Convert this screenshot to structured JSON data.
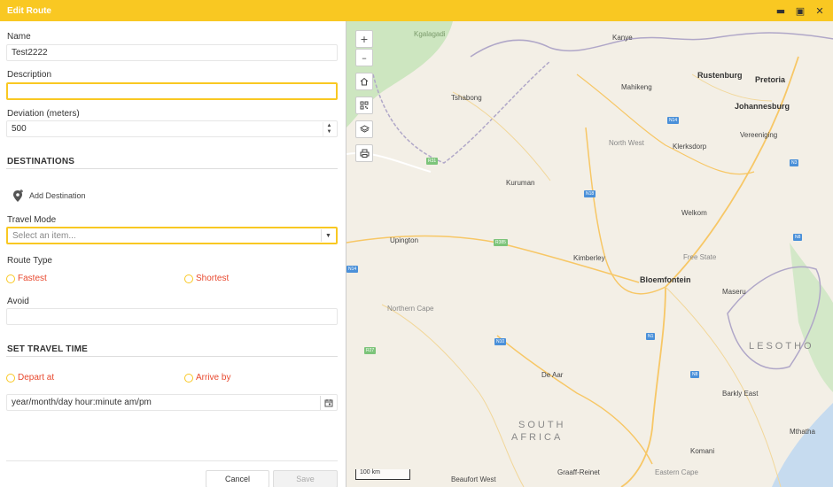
{
  "window": {
    "title": "Edit Route",
    "controls": {
      "minimize": "▬",
      "maximize": "▣",
      "close": "✕"
    }
  },
  "form": {
    "name": {
      "label": "Name",
      "value": "Test2222"
    },
    "description": {
      "label": "Description",
      "value": ""
    },
    "deviation": {
      "label": "Deviation (meters)",
      "value": "500"
    },
    "destinations": {
      "heading": "DESTINATIONS",
      "add_label": "Add Destination"
    },
    "travel_mode": {
      "label": "Travel Mode",
      "placeholder": "Select an item..."
    },
    "route_type": {
      "label": "Route Type",
      "options": [
        "Fastest",
        "Shortest"
      ]
    },
    "avoid": {
      "label": "Avoid",
      "value": ""
    },
    "travel_time": {
      "heading": "SET TRAVEL TIME",
      "options": [
        "Depart at",
        "Arrive by"
      ],
      "datetime_placeholder": "year/month/day hour:minute am/pm"
    },
    "buttons": {
      "cancel": "Cancel",
      "save": "Save"
    }
  },
  "map": {
    "tools": {
      "zoom_in": "+",
      "zoom_out": "–"
    },
    "scale": "100 km",
    "places": {
      "kgalagadi": "Kgalagadi",
      "kanye": "Kanye",
      "rustenburg": "Rustenburg",
      "pretoria": "Pretoria",
      "mahikeng": "Mahikeng",
      "tshabong": "Tshabong",
      "johannesburg": "Johannesburg",
      "north_west": "North West",
      "klerksdorp": "Klerksdorp",
      "vereeniging": "Vereeniging",
      "kuruman": "Kuruman",
      "welkom": "Welkom",
      "upington": "Upington",
      "kimberley": "Kimberley",
      "free_state": "Free State",
      "bloemfontein": "Bloemfontein",
      "maseru": "Maseru",
      "northern_cape": "Northern Cape",
      "lesotho": "LESOTHO",
      "de_aar": "De Aar",
      "barkly_east": "Barkly East",
      "south": "SOUTH",
      "africa": "AFRICA",
      "mthatha": "Mthatha",
      "komani": "Komani",
      "graaff_reinet": "Graaff-Reinet",
      "eastern_cape": "Eastern Cape",
      "beaufort_west": "Beaufort West"
    },
    "roads": [
      "N14",
      "N18",
      "N12",
      "N1",
      "N10",
      "N8",
      "N3",
      "R31",
      "R27",
      "R385"
    ]
  }
}
